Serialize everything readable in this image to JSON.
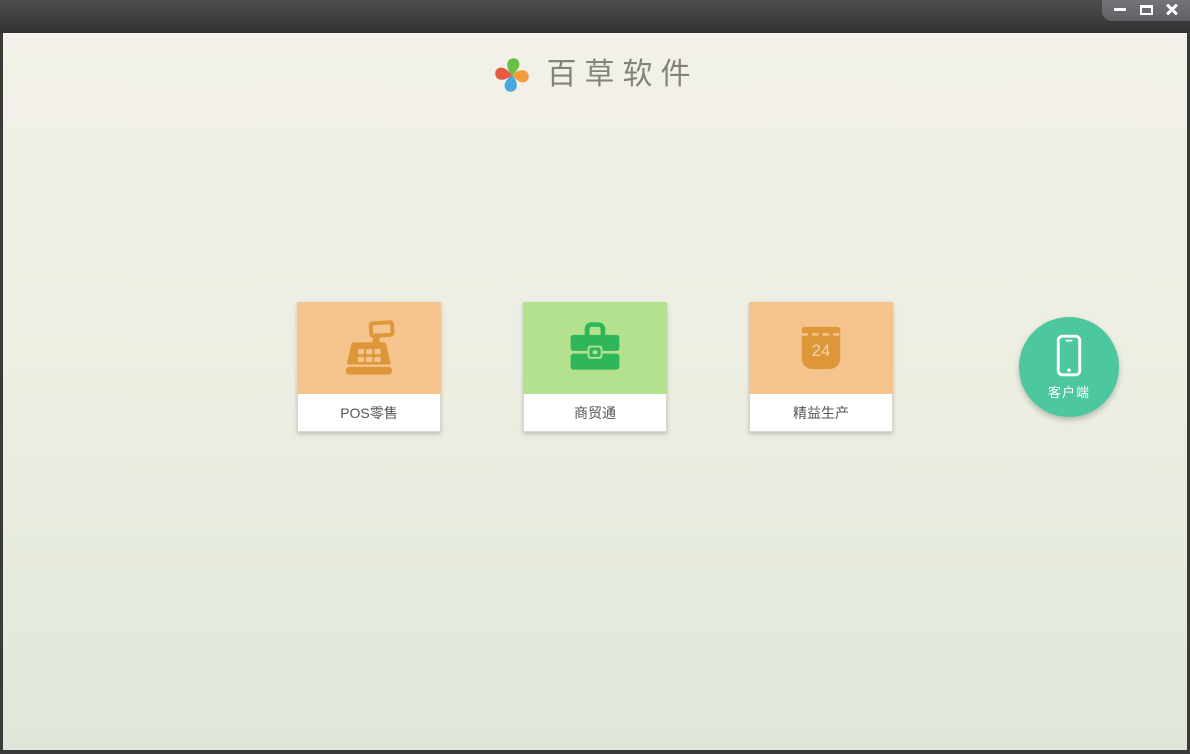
{
  "window": {
    "controls": [
      {
        "name": "minimize-icon"
      },
      {
        "name": "maximize-icon"
      },
      {
        "name": "close-icon"
      }
    ]
  },
  "header": {
    "app_name": "百草软件",
    "logo_icon": "pinwheel-logo-icon",
    "logo_colors": {
      "top": "#6abf47",
      "right": "#f49c3c",
      "bottom": "#4aa8e0",
      "left": "#e55b40"
    }
  },
  "products": [
    {
      "label": "POS零售",
      "icon": "cash-register-icon",
      "colors": {
        "bg": "#f5c48c",
        "icon": "#dd9739"
      }
    },
    {
      "label": "商贸通",
      "icon": "briefcase-icon",
      "colors": {
        "bg": "#b4e18d",
        "icon": "#2fb65a"
      }
    },
    {
      "label": "精益生产",
      "icon": "calendar-icon",
      "icon_text": "24",
      "colors": {
        "bg": "#f5c48c",
        "icon": "#dd9739"
      }
    }
  ],
  "client_button": {
    "label": "客户端",
    "icon": "smartphone-icon",
    "color": "#4cc79e"
  }
}
